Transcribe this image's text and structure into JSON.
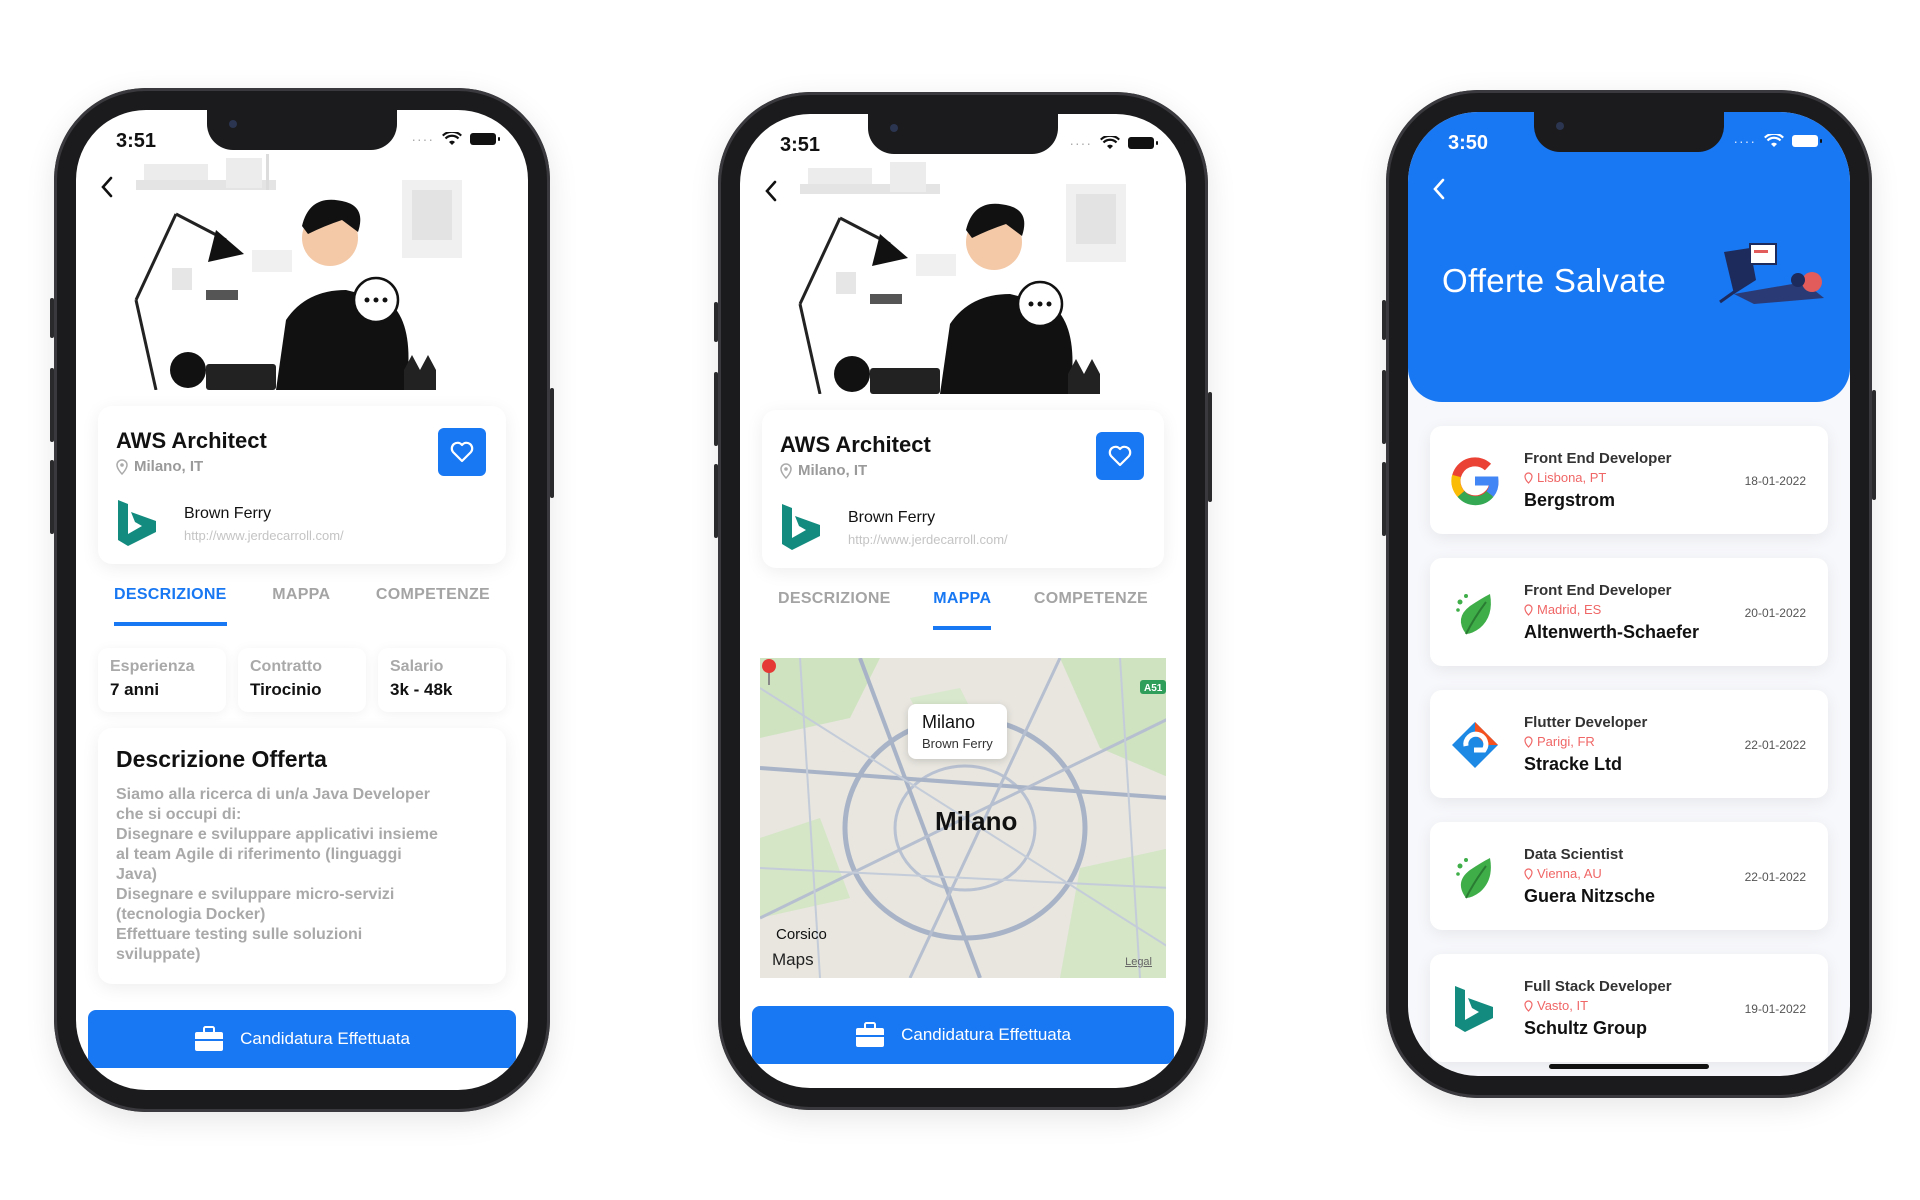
{
  "phone1": {
    "status_time": "3:51",
    "job": {
      "title": "AWS Architect",
      "location": "Milano, IT",
      "company": "Brown Ferry",
      "url": "http://www.jerdecarroll.com/"
    },
    "tabs": [
      "DESCRIZIONE",
      "MAPPA",
      "COMPETENZE"
    ],
    "active_tab": "DESCRIZIONE",
    "info": [
      {
        "label": "Esperienza",
        "value": "7 anni"
      },
      {
        "label": "Contratto",
        "value": "Tirocinio"
      },
      {
        "label": "Salario",
        "value": "3k - 48k"
      }
    ],
    "description": {
      "title": "Descrizione Offerta",
      "lines": [
        "Siamo alla ricerca di un/a Java Developer",
        "che si occupi di:",
        "Disegnare e sviluppare applicativi insieme",
        "al team Agile di riferimento (linguaggi",
        "Java)",
        "Disegnare e sviluppare micro-servizi",
        "(tecnologia Docker)",
        "Effettuare testing sulle soluzioni",
        "sviluppate)"
      ]
    },
    "cta_label": "Candidatura Effettuata"
  },
  "phone2": {
    "status_time": "3:51",
    "job": {
      "title": "AWS Architect",
      "location": "Milano, IT",
      "company": "Brown Ferry",
      "url": "http://www.jerdecarroll.com/"
    },
    "tabs": [
      "DESCRIZIONE",
      "MAPPA",
      "COMPETENZE"
    ],
    "active_tab": "MAPPA",
    "map": {
      "popup_title": "Milano",
      "popup_subtitle": "Brown Ferry",
      "city_label": "Milano",
      "suburb_label": "Corsico",
      "brand": "Maps",
      "legal": "Legal",
      "highway_badge": "A51"
    },
    "cta_label": "Candidatura Effettuata"
  },
  "phone3": {
    "status_time": "3:50",
    "header_title": "Offerte Salvate",
    "offers": [
      {
        "role": "Front End Developer",
        "location": "Lisbona, PT",
        "company": "Bergstrom",
        "date": "18-01-2022",
        "logo": "google-logo"
      },
      {
        "role": "Front End Developer",
        "location": "Madrid, ES",
        "company": "Altenwerth-Schaefer",
        "date": "20-01-2022",
        "logo": "leaf-logo"
      },
      {
        "role": "Flutter Developer",
        "location": "Parigi, FR",
        "company": "Stracke Ltd",
        "date": "22-01-2022",
        "logo": "edge-logo"
      },
      {
        "role": "Data Scientist",
        "location": "Vienna, AU",
        "company": "Guera Nitzsche",
        "date": "22-01-2022",
        "logo": "leaf-logo"
      },
      {
        "role": "Full Stack Developer",
        "location": "Vasto, IT",
        "company": "Schultz Group",
        "date": "19-01-2022",
        "logo": "bing-logo"
      }
    ]
  },
  "colors": {
    "accent": "#1877f2",
    "location_red": "#f06666",
    "muted": "#a9a9a9"
  }
}
